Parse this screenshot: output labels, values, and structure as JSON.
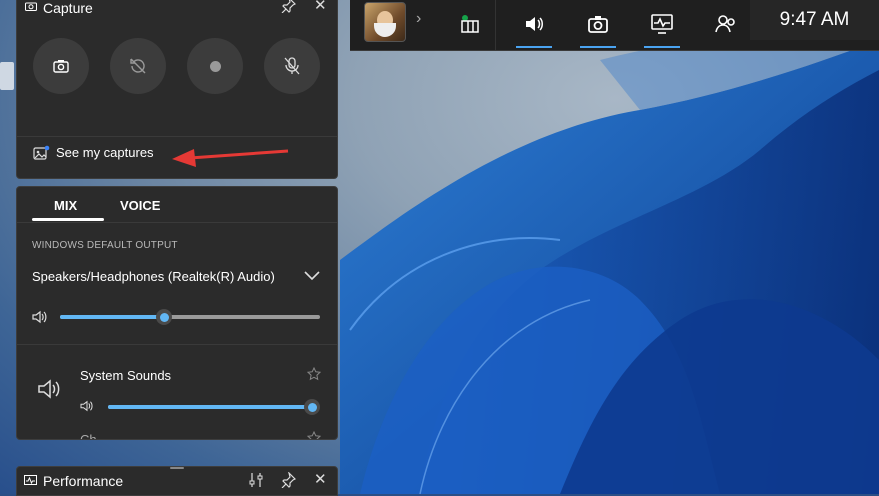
{
  "capture": {
    "title": "Capture",
    "buttons": [
      {
        "name": "screenshot",
        "icon": "camera-icon"
      },
      {
        "name": "record-last",
        "icon": "history-off-icon"
      },
      {
        "name": "record",
        "icon": "record-dot-icon"
      },
      {
        "name": "mic",
        "icon": "mic-off-icon"
      }
    ],
    "see_captures_label": "See my captures"
  },
  "audio": {
    "tabs": [
      "MIX",
      "VOICE"
    ],
    "active_tab": "MIX",
    "section_label": "WINDOWS DEFAULT OUTPUT",
    "output_device": "Speakers/Headphones (Realtek(R) Audio)",
    "master_volume": 0.4,
    "apps": [
      {
        "name": "System Sounds",
        "volume": 1.0
      }
    ]
  },
  "gamebar": {
    "time": "9:47 AM",
    "widgets": [
      "widget-menu-icon",
      "audio-icon",
      "capture-icon",
      "performance-icon",
      "social-icon"
    ]
  },
  "performance": {
    "title": "Performance"
  },
  "colors": {
    "accent": "#62b7f4",
    "panel": "#2b2b2b",
    "annotation_arrow": "#e53935"
  }
}
